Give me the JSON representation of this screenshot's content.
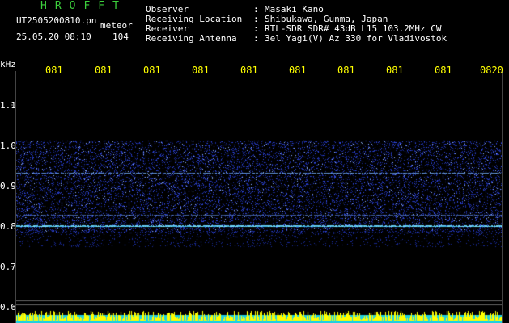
{
  "header": {
    "title": "HROFFT",
    "filename": "UT2505200810.pn",
    "label": "meteor",
    "datetime": "25.05.20 08:10",
    "count": "104",
    "fields": [
      {
        "label": "Observer",
        "value": "Masaki Kano"
      },
      {
        "label": "Receiving Location",
        "value": "Shibukawa, Gunma, Japan"
      },
      {
        "label": "Receiver",
        "value": "RTL-SDR SDR# 43dB L15 103.2MHz CW"
      },
      {
        "label": "Receiving Antenna",
        "value": "3el Yagi(V) Az 330 for Vladivostok"
      }
    ]
  },
  "axis": {
    "unit": "kHz",
    "y_ticks": [
      "1.1",
      "1.0",
      "0.9",
      "0.8",
      "0.7",
      "0.6"
    ],
    "x_ticks": [
      "081",
      "081",
      "081",
      "081",
      "081",
      "081",
      "081",
      "081",
      "081",
      "0820"
    ]
  },
  "colors": {
    "title": "#3ccf3c",
    "tick_labels": "#ffff00",
    "background": "#000000",
    "noise": "#2a3fd6",
    "signal": "#6fd8ff",
    "bottom_band": "#1fd0e0",
    "bottom_spikes": "#ffff00"
  }
}
